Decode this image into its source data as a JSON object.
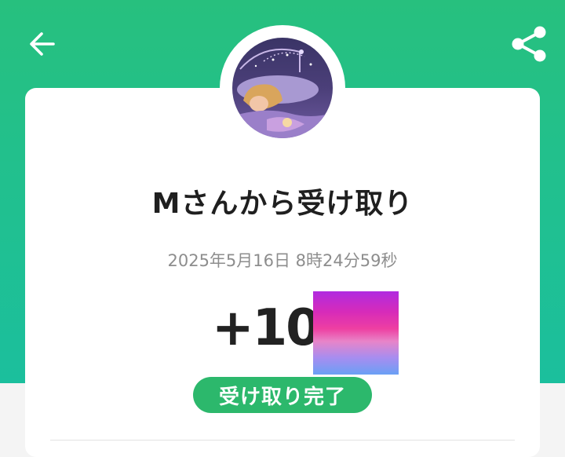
{
  "header": {
    "background_color": "#22c08c",
    "back_icon": "arrow-left-icon",
    "share_icon": "share-icon"
  },
  "receipt": {
    "title": "Mさんから受け取り",
    "timestamp": "2025年5月16日 8時24分59秒",
    "amount": "+10",
    "status": "受け取り完了",
    "status_color": "#2cb86c"
  }
}
